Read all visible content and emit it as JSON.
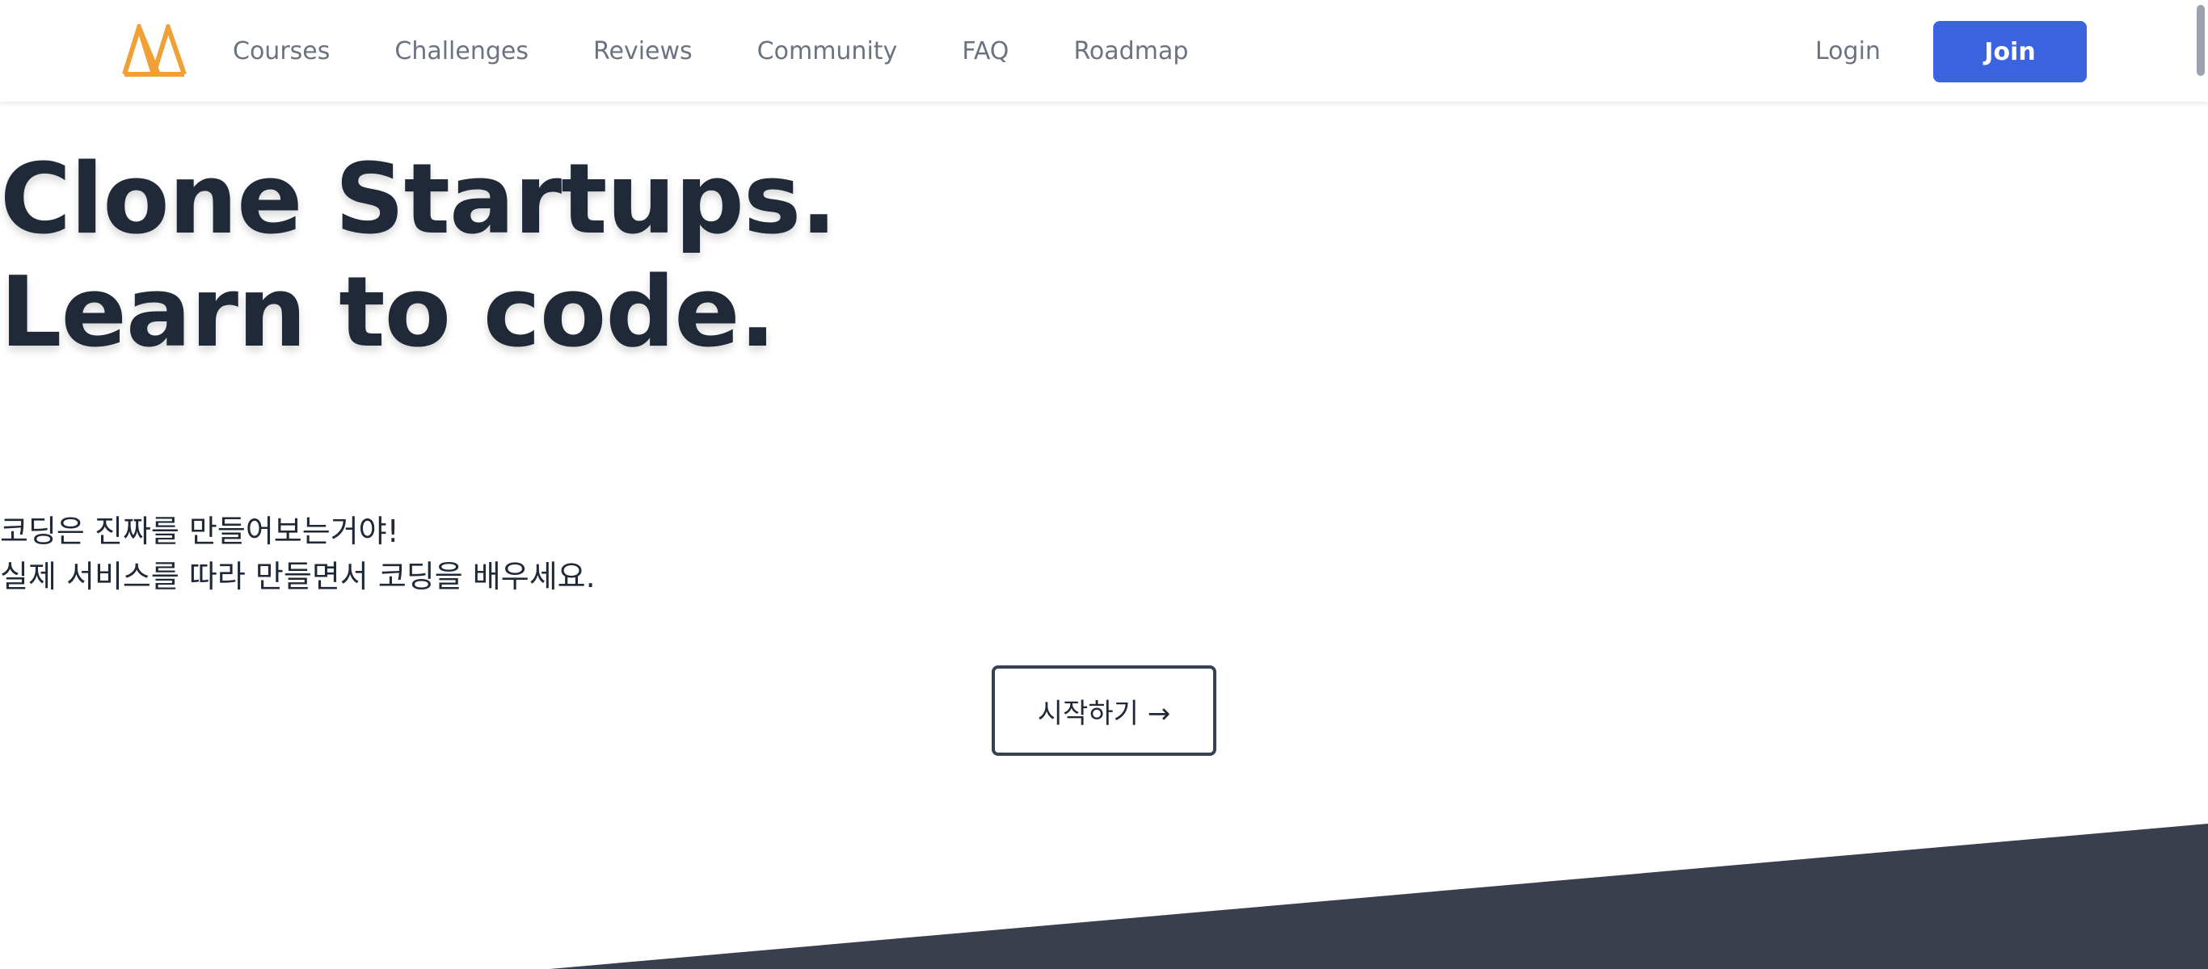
{
  "brand": {
    "logo_icon": "mountain-logo-icon",
    "logo_color": "#f0a035"
  },
  "nav": {
    "items": [
      {
        "label": "Courses"
      },
      {
        "label": "Challenges"
      },
      {
        "label": "Reviews"
      },
      {
        "label": "Community"
      },
      {
        "label": "FAQ"
      },
      {
        "label": "Roadmap"
      }
    ]
  },
  "auth": {
    "login_label": "Login",
    "join_label": "Join",
    "join_color": "#3b63e0"
  },
  "hero": {
    "headline_line1": "Clone Startups.",
    "headline_line2": "Learn to code.",
    "subtitle_line1": "코딩은 진짜를 만들어보는거야!",
    "subtitle_line2": "실제 서비스를 따라 만들면서 코딩을 배우세요.",
    "cta_label": "시작하기 →"
  },
  "colors": {
    "text_dark": "#1f2937",
    "nav_text": "#6b7280",
    "band_dark": "#3a3f4e"
  }
}
